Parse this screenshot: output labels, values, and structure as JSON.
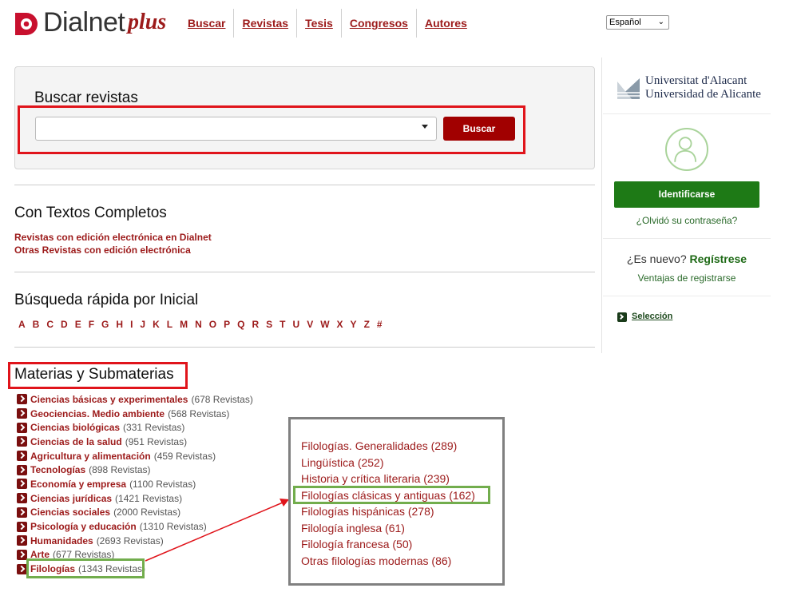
{
  "header": {
    "logo_text": "Dialnet",
    "logo_plus": "plus",
    "nav": [
      "Buscar",
      "Revistas",
      "Tesis",
      "Congresos",
      "Autores"
    ],
    "language": "Español"
  },
  "search": {
    "title": "Buscar revistas",
    "input_value": "",
    "button": "Buscar"
  },
  "full_text": {
    "title": "Con Textos Completos",
    "links": [
      "Revistas con edición electrónica en Dialnet",
      "Otras Revistas con edición electrónica"
    ]
  },
  "quick": {
    "title": "Búsqueda rápida por Inicial",
    "letters": [
      "A",
      "B",
      "C",
      "D",
      "E",
      "F",
      "G",
      "H",
      "I",
      "J",
      "K",
      "L",
      "M",
      "N",
      "O",
      "P",
      "Q",
      "R",
      "S",
      "T",
      "U",
      "V",
      "W",
      "X",
      "Y",
      "Z",
      "#"
    ]
  },
  "subjects": {
    "title": "Materias y Submaterias",
    "items": [
      {
        "name": "Ciencias básicas y experimentales",
        "count": "(678 Revistas)"
      },
      {
        "name": "Geociencias. Medio ambiente",
        "count": "(568 Revistas)"
      },
      {
        "name": "Ciencias biológicas",
        "count": "(331 Revistas)"
      },
      {
        "name": "Ciencias de la salud",
        "count": "(951 Revistas)"
      },
      {
        "name": "Agricultura y alimentación",
        "count": "(459 Revistas)"
      },
      {
        "name": "Tecnologías",
        "count": "(898 Revistas)"
      },
      {
        "name": "Economía y empresa",
        "count": "(1100 Revistas)"
      },
      {
        "name": "Ciencias jurídicas",
        "count": "(1421 Revistas)"
      },
      {
        "name": "Ciencias sociales",
        "count": "(2000 Revistas)"
      },
      {
        "name": "Psicología y educación",
        "count": "(1310 Revistas)"
      },
      {
        "name": "Humanidades",
        "count": "(2693 Revistas)"
      },
      {
        "name": "Arte",
        "count": "(677 Revistas)"
      },
      {
        "name": "Filologías",
        "count": "(1343 Revistas)"
      }
    ]
  },
  "submaterias": [
    "Filologías. Generalidades (289)",
    "Lingüística (252)",
    "Historia y crítica literaria (239)",
    "Filologías clásicas y antiguas (162)",
    "Filologías hispánicas (278)",
    "Filología inglesa (61)",
    "Filología francesa (50)",
    "Otras filologías modernas (86)"
  ],
  "sidebar": {
    "university_line1": "Universitat d'Alacant",
    "university_line2": "Universidad de Alicante",
    "login_button": "Identificarse",
    "forgot": "¿Olvidó su contraseña?",
    "new_question": "¿Es nuevo?",
    "register": "Regístrese",
    "advantages": "Ventajas de registrarse",
    "selection": "Selección"
  },
  "colors": {
    "brand_red": "#9c1a1a",
    "button_red": "#a10000",
    "login_green": "#1e7a16",
    "highlight_red": "#e0141b",
    "highlight_green": "#72ad4d"
  }
}
